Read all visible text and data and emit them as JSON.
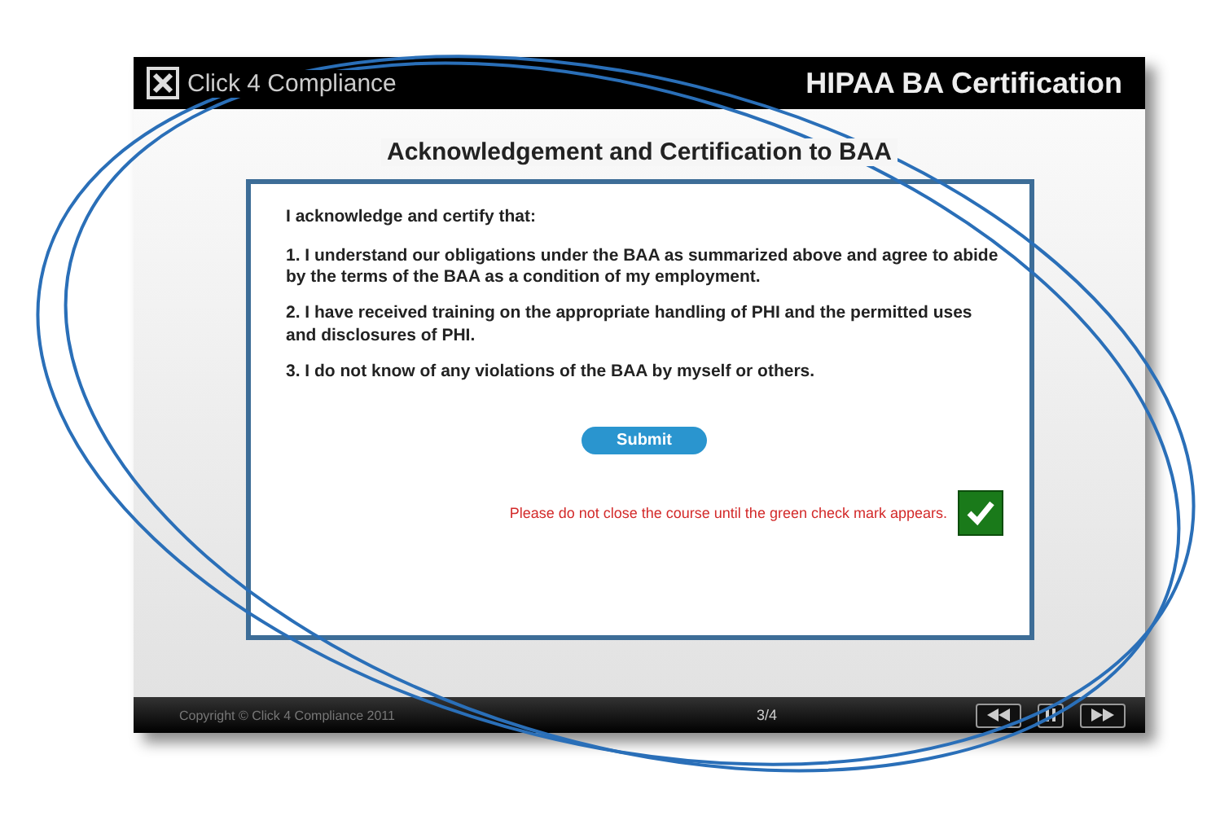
{
  "header": {
    "logo_text": "Click 4 Compliance",
    "course_title": "HIPAA BA Certification"
  },
  "slide": {
    "title": "Acknowledgement and Certification to BAA",
    "intro": "I acknowledge and certify that:",
    "items": [
      {
        "number": "1.",
        "text": "I understand our obligations under the BAA as summarized above and agree to abide by the terms of the BAA as a condition of my employment."
      },
      {
        "number": "2.",
        "text": "I have received training on the appropriate handling of PHI and the permitted uses and disclosures of PHI."
      },
      {
        "number": "3.",
        "text": "I do not know of any violations of the BAA by myself or others."
      }
    ],
    "submit_button": "Submit",
    "notice": "Please do not close the course until the green check mark appears.",
    "completed": true
  },
  "footer": {
    "copyright": "Copyright © Click 4 Compliance 2011",
    "page": "3/4"
  }
}
